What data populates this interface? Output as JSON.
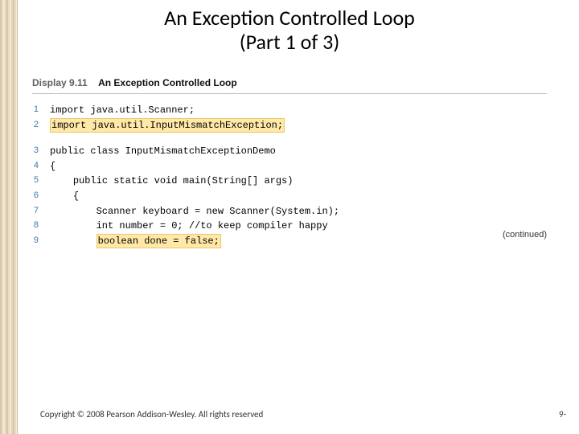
{
  "title_line1": "An Exception Controlled Loop",
  "title_line2": "(Part 1 of 3)",
  "display": {
    "label": "Display 9.11",
    "caption": "An Exception Controlled Loop"
  },
  "code": {
    "rows": [
      {
        "n": "1",
        "pre": "",
        "text": "import java.util.Scanner;",
        "hl": false
      },
      {
        "n": "2",
        "pre": "",
        "text": "import java.util.InputMismatchException;",
        "hl": true
      },
      {
        "n": "",
        "pre": "",
        "text": "",
        "hl": false
      },
      {
        "n": "3",
        "pre": "",
        "text": "public class InputMismatchExceptionDemo",
        "hl": false
      },
      {
        "n": "4",
        "pre": "",
        "text": "{",
        "hl": false
      },
      {
        "n": "5",
        "pre": "    ",
        "text": "public static void main(String[] args)",
        "hl": false
      },
      {
        "n": "6",
        "pre": "    ",
        "text": "{",
        "hl": false
      },
      {
        "n": "7",
        "pre": "        ",
        "text": "Scanner keyboard = new Scanner(System.in);",
        "hl": false
      },
      {
        "n": "8",
        "pre": "        ",
        "text": "int number = 0; //to keep compiler happy",
        "hl": false
      },
      {
        "n": "9",
        "pre": "        ",
        "text": "boolean done = false;",
        "hl": true
      }
    ]
  },
  "continued": "(continued)",
  "footer": {
    "copyright": "Copyright © 2008 Pearson Addison-Wesley. All rights reserved",
    "pagenum": "9-"
  }
}
